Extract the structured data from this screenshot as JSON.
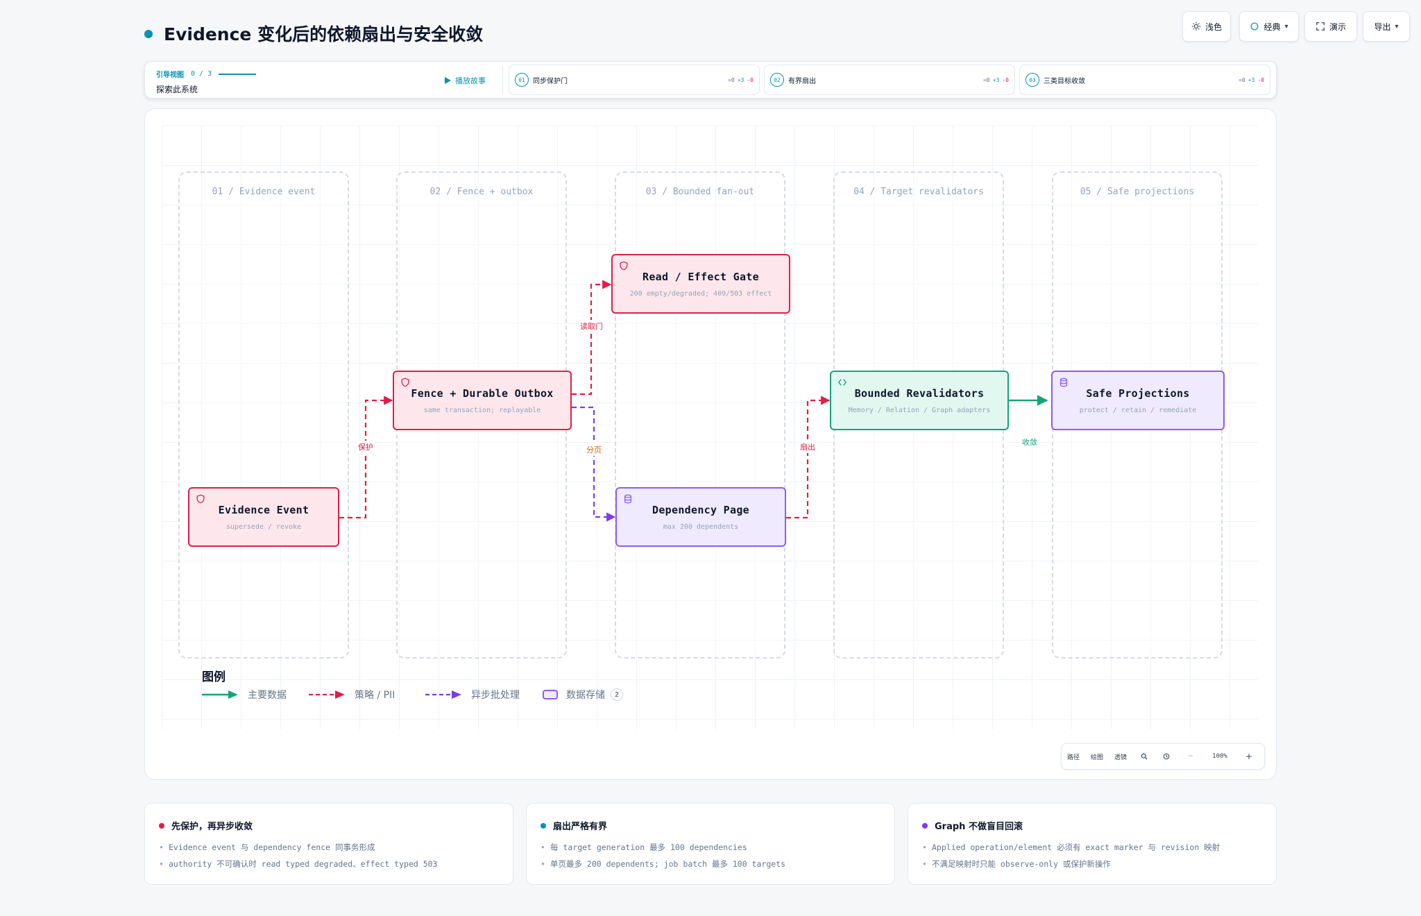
{
  "header": {
    "title": "Evidence 变化后的依赖扇出与安全收敛",
    "accent": "#0891b2",
    "buttons": {
      "theme": "浅色",
      "style": "经典",
      "present": "演示",
      "export": "导出"
    }
  },
  "story": {
    "guide_label": "引导视图",
    "progress": "0 / 3",
    "guide_title": "探索此系统",
    "play_label": "播放故事",
    "steps": [
      {
        "num": "01",
        "label": "同步保护门",
        "eq": "=0",
        "plus": "+3",
        "minus": "-0"
      },
      {
        "num": "02",
        "label": "有界扇出",
        "eq": "=0",
        "plus": "+3",
        "minus": "-0"
      },
      {
        "num": "03",
        "label": "三类目标收敛",
        "eq": "=0",
        "plus": "+3",
        "minus": "-0"
      }
    ]
  },
  "diagram": {
    "lanes": [
      "01 / Evidence event",
      "02 / Fence + outbox",
      "03 / Bounded fan-out",
      "04 / Target revalidators",
      "05 / Safe projections"
    ],
    "nodes": {
      "evidence_event": {
        "title": "Evidence Event",
        "sub": "supersede / revoke",
        "icon": "shield-icon"
      },
      "fence_outbox": {
        "title": "Fence + Durable Outbox",
        "sub": "same transaction; replayable",
        "icon": "shield-icon"
      },
      "read_effect_gate": {
        "title": "Read / Effect Gate",
        "sub": "200 empty/degraded; 409/503 effect",
        "icon": "shield-icon"
      },
      "dependency_page": {
        "title": "Dependency Page",
        "sub": "max 200 dependents",
        "icon": "database-icon"
      },
      "bounded_revalidators": {
        "title": "Bounded Revalidators",
        "sub": "Memory / Relation / Graph adapters",
        "icon": "code-icon"
      },
      "safe_projections": {
        "title": "Safe Projections",
        "sub": "protect / retain / remediate",
        "icon": "database-icon"
      }
    },
    "edge_labels": {
      "protect": "保护",
      "read_gate": "读取门",
      "paging": "分页",
      "fanout": "扇出",
      "converge": "收敛"
    },
    "colors": {
      "primary": "#16a37a",
      "policy": "#e11d48",
      "async": "#7c3aed",
      "store": "#8b5cf6"
    }
  },
  "legend": {
    "title": "图例",
    "primary": "主要数据",
    "policy": "策略 / PII",
    "async": "异步批处理",
    "store": "数据存储",
    "store_count": "2"
  },
  "controls": {
    "path": "路径",
    "draw": "绘图",
    "lens": "透镜",
    "zoom": "100%",
    "minus": "−",
    "plus": "+"
  },
  "cards": [
    {
      "title": "先保护，再异步收敛",
      "dot": "#e11d48",
      "items": [
        "Evidence event 与 dependency fence 同事务形成",
        "authority 不可确认时 read typed degraded、effect typed 503"
      ]
    },
    {
      "title": "扇出严格有界",
      "dot": "#0891b2",
      "items": [
        "每 target generation 最多 100 dependencies",
        "单页最多 200 dependents; job batch 最多 100 targets"
      ]
    },
    {
      "title": "Graph 不做盲目回滚",
      "dot": "#7c3aed",
      "items": [
        "Applied operation/element 必须有 exact marker 与 revision 映射",
        "不满足映射时只能 observe-only 或保护新操作"
      ]
    }
  ]
}
